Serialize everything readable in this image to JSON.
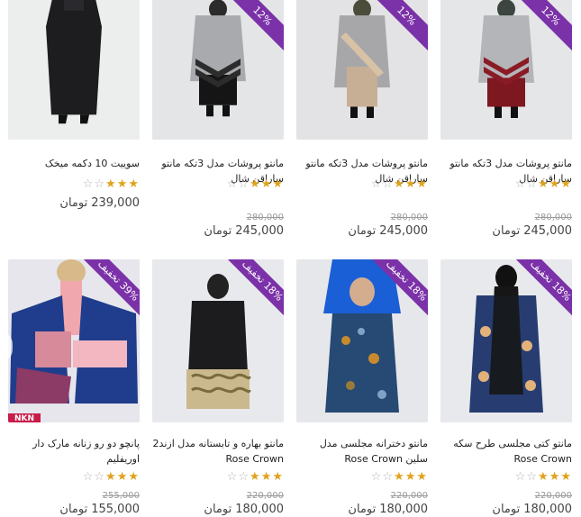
{
  "currency": "تومان",
  "products": [
    {
      "title": "سوییت 10 دکمه میخک",
      "rating": 3,
      "old_price": "",
      "price": "239,000",
      "discount": "",
      "photo": "black-suit"
    },
    {
      "title": "مانتو پروشات مدل 3تکه مانتو ساراقن شال",
      "rating": 3,
      "old_price": "280,000",
      "price": "245,000",
      "discount": "12%",
      "photo": "grey-black"
    },
    {
      "title": "مانتو پروشات مدل 3تکه مانتو ساراقن شال",
      "rating": 3,
      "old_price": "280,000",
      "price": "245,000",
      "discount": "12%",
      "photo": "grey-beige"
    },
    {
      "title": "مانتو پروشات مدل 3تکه مانتو ساراقن شال",
      "rating": 3,
      "old_price": "280,000",
      "price": "245,000",
      "discount": "12%",
      "photo": "grey-red"
    },
    {
      "title": "پانچو دو رو زنانه مارک دار اوریفلیم",
      "rating": 3,
      "old_price": "255,000",
      "price": "155,000",
      "discount": "39% تخفیف",
      "photo": "poncho",
      "brand_tag": "NKN"
    },
    {
      "title": "مانتو بهاره و تابستانه مدل ازند2 Rose Crown",
      "rating": 3,
      "old_price": "220,000",
      "price": "180,000",
      "discount": "18% تخفیف",
      "photo": "black-embroidered"
    },
    {
      "title": "مانتو دخترانه مجلسی مدل سلین Rose Crown",
      "rating": 3,
      "old_price": "220,000",
      "price": "180,000",
      "discount": "18% تخفیف",
      "photo": "blue-floral"
    },
    {
      "title": "مانتو کتی مجلسی طرح سکه Rose Crown",
      "rating": 3,
      "old_price": "220,000",
      "price": "180,000",
      "discount": "18% تخفیف",
      "photo": "navy-paisley"
    }
  ]
}
